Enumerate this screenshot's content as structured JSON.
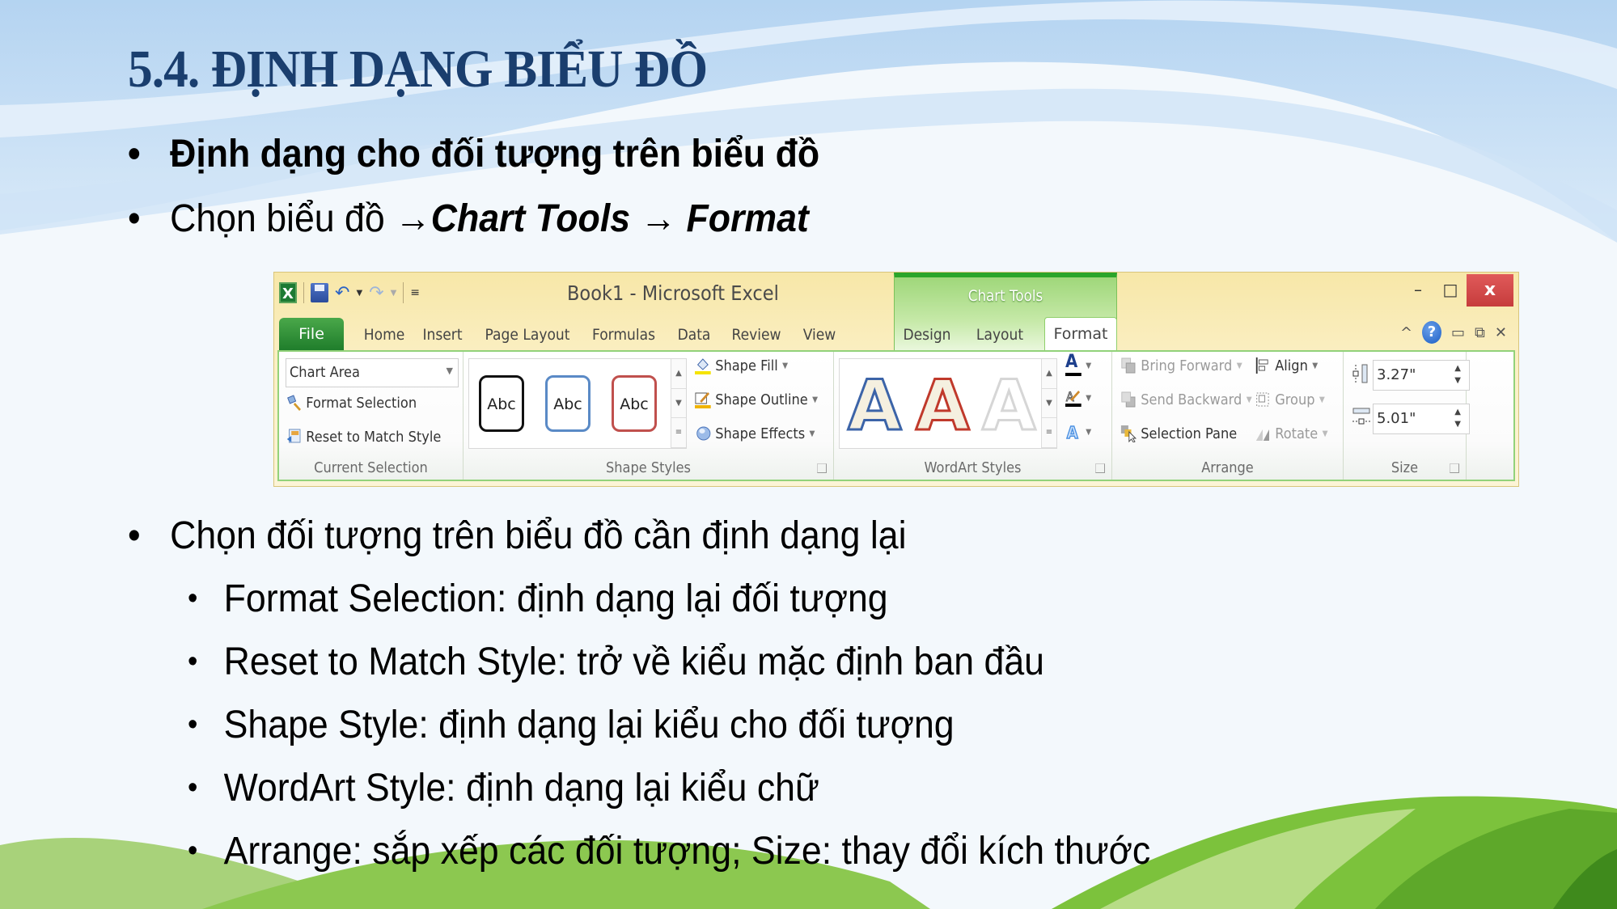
{
  "slide": {
    "title": "5.4. ĐỊNH DẠNG BIỂU ĐỒ",
    "bullets": [
      {
        "text": "Định dạng cho đối tượng trên biểu đồ"
      },
      {
        "prefix": "Chọn biểu đồ ",
        "part1": "→Chart Tools",
        "part2": " → Format"
      },
      {
        "text": "Chọn đối tượng trên biểu đồ cần định dạng lại"
      }
    ],
    "sub_bullets": [
      "Format Selection: định dạng lại đối tượng",
      "Reset to Match Style: trở về kiểu mặc định ban đầu",
      "Shape Style: định dạng lại kiểu cho đối tượng",
      "WordArt Style: định dạng lại kiểu chữ",
      "Arrange: sắp xếp các đối tượng; Size: thay đổi kích thước"
    ],
    "bullet_char": "•"
  },
  "ribbon": {
    "window_title": "Book1 - Microsoft Excel",
    "contextual_label": "Chart Tools",
    "window_controls": {
      "minimize": "–",
      "maximize": "□",
      "close": "x"
    },
    "help_controls": {
      "collapse": "^",
      "help": "?",
      "min": "▭",
      "restore": "⧉",
      "close": "✕"
    },
    "tabs": [
      "File",
      "Home",
      "Insert",
      "Page Layout",
      "Formulas",
      "Data",
      "Review",
      "View",
      "Design",
      "Layout",
      "Format"
    ],
    "active_tab": "Format",
    "groups": {
      "current_selection": {
        "label": "Current Selection",
        "dropdown_value": "Chart Area",
        "format_selection": "Format Selection",
        "reset_to_match": "Reset to Match Style"
      },
      "shape_styles": {
        "label": "Shape Styles",
        "presets": [
          "Abc",
          "Abc",
          "Abc"
        ],
        "preset_colors": [
          "#111111",
          "#5a8ac6",
          "#c0504d"
        ],
        "shape_fill": "Shape Fill",
        "shape_outline": "Shape Outline",
        "shape_effects": "Shape Effects"
      },
      "wordart_styles": {
        "label": "WordArt Styles",
        "presets": [
          "A",
          "A",
          "A"
        ],
        "text_fill": "A"
      },
      "arrange": {
        "label": "Arrange",
        "bring_forward": "Bring Forward",
        "send_backward": "Send Backward",
        "selection_pane": "Selection Pane",
        "align": "Align",
        "group": "Group",
        "rotate": "Rotate"
      },
      "size": {
        "label": "Size",
        "height": "3.27\"",
        "width": "5.01\""
      }
    }
  },
  "colors": {
    "title": "#1a3e6e",
    "excel_green": "#1f7d2b",
    "close_red": "#c63c3c"
  }
}
